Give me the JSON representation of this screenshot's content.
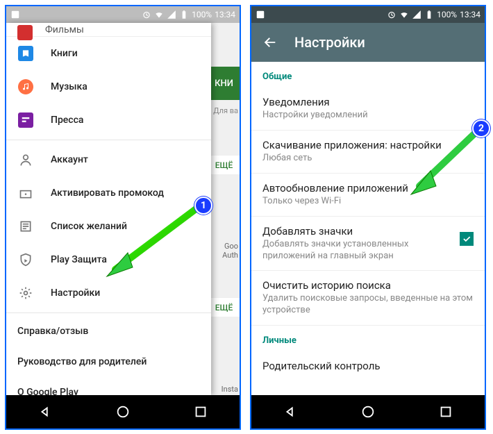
{
  "status": {
    "time": "13:34",
    "battery": "100%"
  },
  "left": {
    "peek_top": "Фильмы",
    "categories": [
      {
        "label": "Книги"
      },
      {
        "label": "Музыка"
      },
      {
        "label": "Пресса"
      }
    ],
    "items": [
      {
        "label": "Аккаунт"
      },
      {
        "label": "Активировать промокод"
      },
      {
        "label": "Список желаний"
      },
      {
        "label": "Play Защита"
      },
      {
        "label": "Настройки"
      }
    ],
    "footer": [
      "Справка/отзыв",
      "Руководство для родителей",
      "О Google Play"
    ],
    "bg_green": "КНИ",
    "bg_more": "ЕЩЁ",
    "bg_text1": "Для ва",
    "bg_text2": "Goo",
    "bg_text3": "Auth",
    "bg_text4": "Insta"
  },
  "right": {
    "title": "Настройки",
    "section_general": "Общие",
    "section_personal": "Личные",
    "settings": [
      {
        "title": "Уведомления",
        "sub": "Настройки уведомлений"
      },
      {
        "title": "Скачивание приложения: настройки",
        "sub": "Любая сеть"
      },
      {
        "title": "Автообновление приложений",
        "sub": "Только через Wi-Fi"
      },
      {
        "title": "Добавлять значки",
        "sub": "Добавлять значки установленных приложений на главный экран",
        "checked": true
      },
      {
        "title": "Очистить историю поиска",
        "sub": "Удалить поисковые запросы, введенные на этом устройстве"
      },
      {
        "title": "Родительский контроль",
        "sub": ""
      }
    ]
  },
  "badges": {
    "one": "1",
    "two": "2"
  }
}
